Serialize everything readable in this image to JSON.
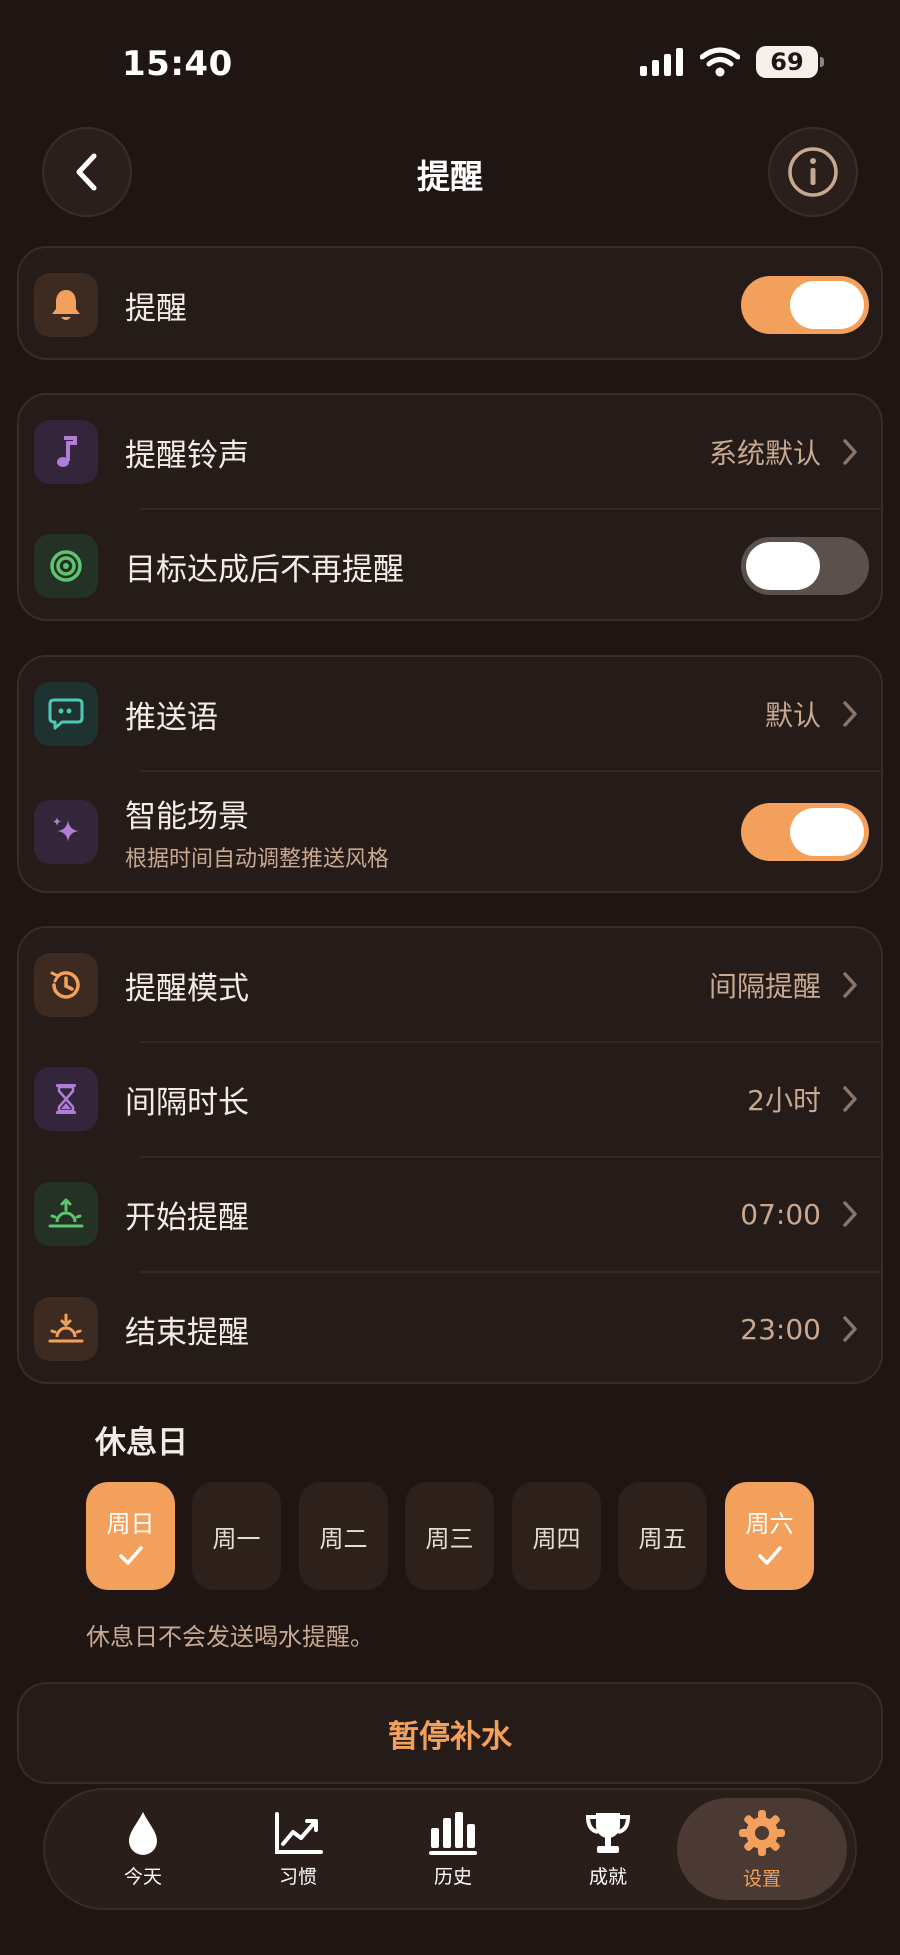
{
  "status_bar": {
    "time": "15:40",
    "battery": "69"
  },
  "header": {
    "title": "提醒"
  },
  "reminder": {
    "label": "提醒",
    "enabled": true
  },
  "sound_group": {
    "ringtone": {
      "label": "提醒铃声",
      "value": "系统默认"
    },
    "stop_after_goal": {
      "label": "目标达成后不再提醒",
      "enabled": false
    }
  },
  "push_group": {
    "push_text": {
      "label": "推送语",
      "value": "默认"
    },
    "smart_scene": {
      "label": "智能场景",
      "sub": "根据时间自动调整推送风格",
      "enabled": true
    }
  },
  "schedule_group": {
    "mode": {
      "label": "提醒模式",
      "value": "间隔提醒"
    },
    "interval": {
      "label": "间隔时长",
      "value": "2小时"
    },
    "start": {
      "label": "开始提醒",
      "value": "07:00"
    },
    "end": {
      "label": "结束提醒",
      "value": "23:00"
    }
  },
  "rest_days": {
    "title": "休息日",
    "days": [
      {
        "label": "周日",
        "active": true
      },
      {
        "label": "周一",
        "active": false
      },
      {
        "label": "周二",
        "active": false
      },
      {
        "label": "周三",
        "active": false
      },
      {
        "label": "周四",
        "active": false
      },
      {
        "label": "周五",
        "active": false
      },
      {
        "label": "周六",
        "active": true
      }
    ],
    "note": "休息日不会发送喝水提醒。"
  },
  "pause_button": "暂停补水",
  "tabs": [
    {
      "label": "今天",
      "icon": "water-drop-icon",
      "active": false
    },
    {
      "label": "习惯",
      "icon": "trend-chart-icon",
      "active": false
    },
    {
      "label": "历史",
      "icon": "bar-chart-icon",
      "active": false
    },
    {
      "label": "成就",
      "icon": "trophy-icon",
      "active": false
    },
    {
      "label": "设置",
      "icon": "gear-icon",
      "active": true
    }
  ],
  "colors": {
    "accent": "#f2a05c",
    "background": "#1f1614",
    "card": "#251b18"
  }
}
